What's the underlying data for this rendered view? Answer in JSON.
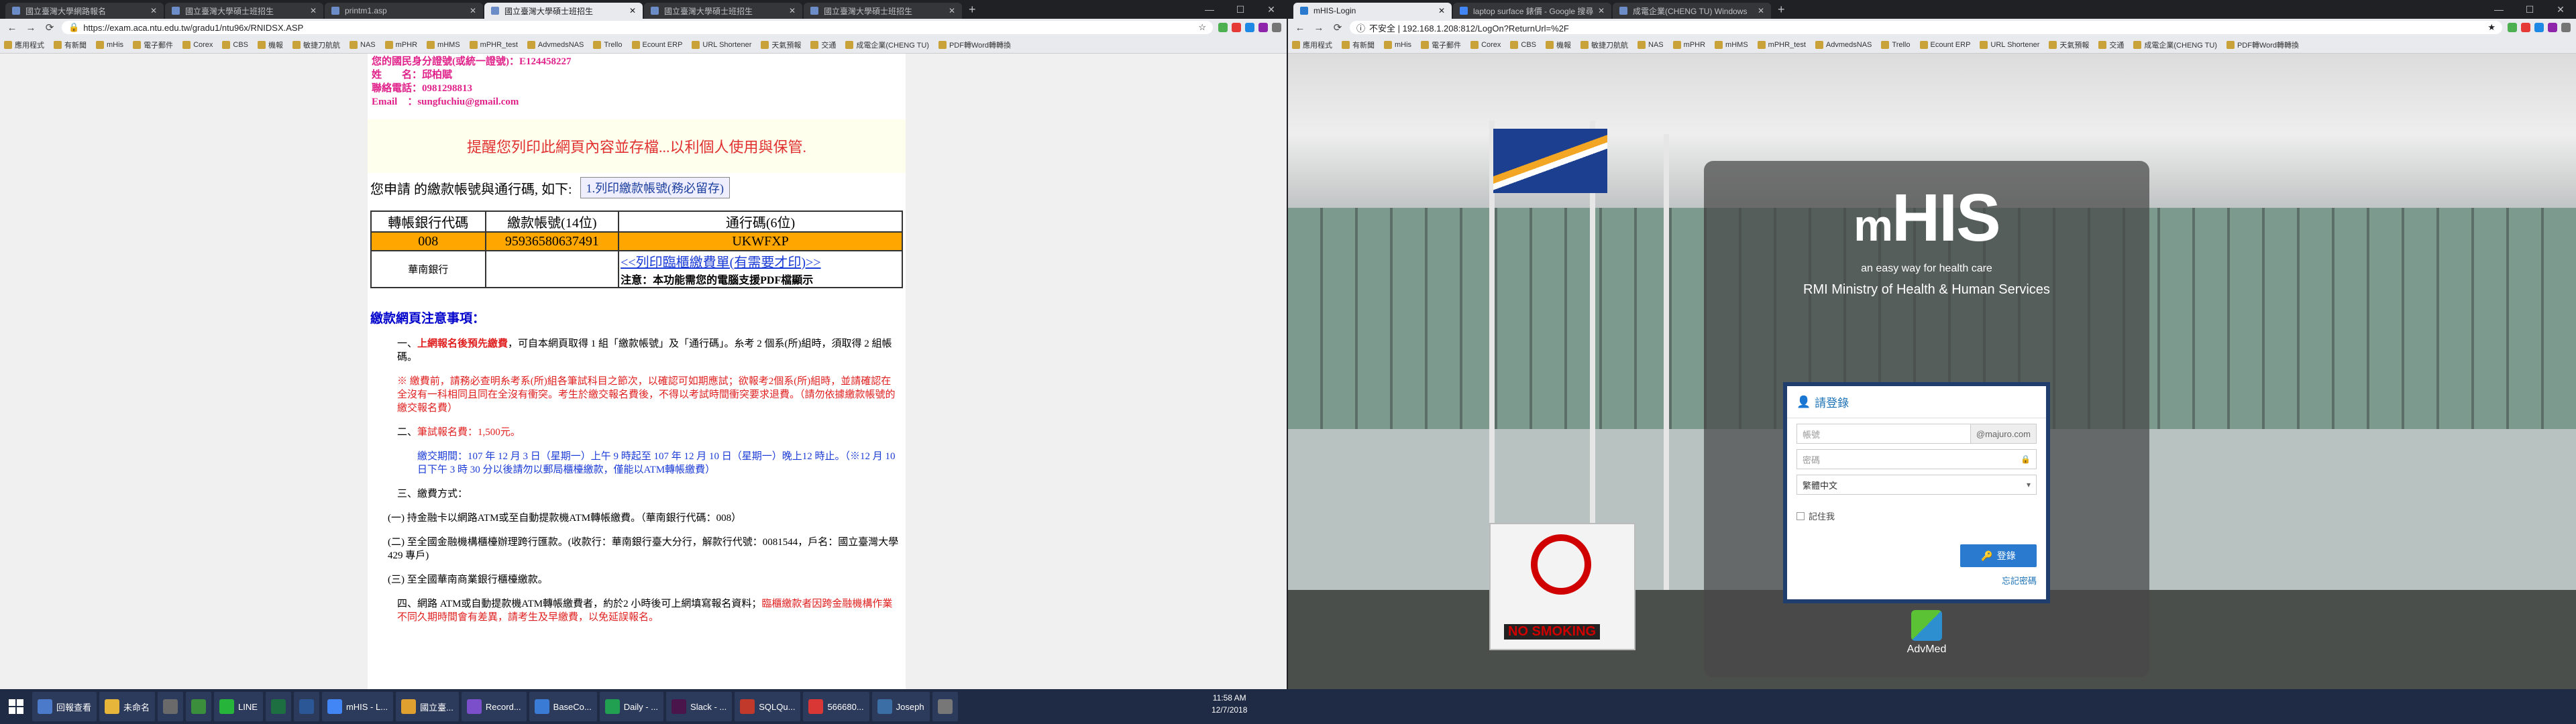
{
  "left": {
    "tabs": [
      "國立臺灣大學網路報名",
      "國立臺灣大學碩士班招生",
      "printm1.asp",
      "國立臺灣大學碩士班招生",
      "國立臺灣大學碩士班招生",
      "國立臺灣大學碩士班招生"
    ],
    "url": "https://exam.aca.ntu.edu.tw/gradu1/ntu96x/RNIDSX.ASP",
    "bookmarks": [
      "應用程式",
      "有新聞",
      "mHis",
      "電子郵件",
      "Corex",
      "CBS",
      "機報",
      "敏捷刀航航",
      "NAS",
      "mPHR",
      "mHMS",
      "mPHR_test",
      "AdvmedsNAS",
      "Trello",
      "Ecount ERP",
      "URL Shortener",
      "天氣預報",
      "交通",
      "成電企業(CHENG TU)",
      "PDF轉Word轉轉換"
    ],
    "applicant": {
      "id_line": "您的國民身分證號(或統一證號)：E124458227",
      "name_line": "姓　　名：邱柏賦",
      "phone_line": "聯絡電話：0981298813",
      "email_line": "Email　：sungfuchiu@gmail.com"
    },
    "notice": "提醒您列印此網頁內容並存檔...以利個人使用與保管.",
    "apply_label": "您申請 的繳款帳號與通行碼, 如下:",
    "print_button": "1.列印繳款帳號(務必留存)",
    "table": {
      "headers": [
        "轉帳銀行代碼",
        "繳款帳號(14位)",
        "通行碼(6位)"
      ],
      "row": [
        "008",
        "95936580637491",
        "UKWFXP"
      ],
      "bank_name": "華南銀行",
      "print_link": "<<列印臨櫃繳費單(有需要才印)>>",
      "pdf_note": "注意：本功能需您的電腦支援PDF檔顯示"
    },
    "notes_title": "繳款網頁注意事項：",
    "notes": [
      {
        "prefix": "一、",
        "red": "上網報名後預先繳費",
        "text": "，可自本網頁取得 1 組「繳款帳號」及「通行碼」。糸考 2 個系(所)組時，須取得 2 組帳碼。"
      },
      {
        "prefix": "※ ",
        "red": "繳費前，請務必查明糸考系(所)組各筆試科目之節次，以確認可如期應試；欲報考2個系(所)組時，並請確認在全沒有一科相同且同在全沒有衝突。考生於繳交報名費後，不得以考試時間衝突要求退費。（請勿依據繳款帳號的繳交報名費）",
        "text": ""
      },
      {
        "prefix": "二、",
        "red": "筆試報名費：1,500元。",
        "text": ""
      },
      {
        "prefix": "",
        "red": "",
        "text": "繳交期間：107 年 12 月 3 日（星期一）上午 9 時起至 107 年 12 月 10 日（星期一）晚上12 時止。（※12 月 10 日下午 3 時 30 分以後請勿以郵局櫃檯繳款，僅能以ATM轉帳繳費）"
      },
      {
        "prefix": "三、",
        "red": "",
        "text": "繳費方式："
      },
      {
        "prefix": "",
        "red": "",
        "text": "(一) 持金融卡以網路ATM或至自動提款機ATM轉帳繳費。（華南銀行代碼：008）"
      },
      {
        "prefix": "",
        "red": "",
        "text": "(二) 至全國金融機構櫃檯辦理跨行匯款。(收款行：華南銀行臺大分行，解款行代號：0081544，戶名：國立臺灣大學 429 專戶)"
      },
      {
        "prefix": "",
        "red": "",
        "text": "(三) 至全國華南商業銀行櫃檯繳款。"
      },
      {
        "prefix": "四、",
        "red": "",
        "text": "網路 ATM或自動提款機ATM轉帳繳費者，約於2 小時後可上網填寫報名資料；",
        "red2": "臨櫃繳款者因跨金融機構作業不同久期時間會有差異，請考生及早繳費，以免延誤報名。"
      }
    ]
  },
  "right": {
    "tabs": [
      "mHIS-Login",
      "laptop surface 錶價 - Google 搜尋",
      "成電企業(CHENG TU) Windows"
    ],
    "url": "不安全 | 192.168.1.208:812/LogOn?ReturnUrl=%2F",
    "bookmarks": [
      "應用程式",
      "有新聞",
      "mHis",
      "電子郵件",
      "Corex",
      "CBS",
      "機報",
      "敏捷刀航航",
      "NAS",
      "mPHR",
      "mHMS",
      "mPHR_test",
      "AdvmedsNAS",
      "Trello",
      "Ecount ERP",
      "URL Shortener",
      "天氣預報",
      "交通",
      "成電企業(CHENG TU)",
      "PDF轉Word轉轉換"
    ],
    "logo_m": "m",
    "logo_his": "HIS",
    "tagline": "an easy way for health care",
    "ministry": "RMI Ministry of Health & Human Services",
    "login_title": "請登錄",
    "account_placeholder": "帳號",
    "domain_suffix": "@majuro.com",
    "password_placeholder": "密碼",
    "language_value": "繁體中文",
    "remember_label": "記住我",
    "login_button": "登錄",
    "forgot_link": "忘記密碼",
    "adv_logo": "AdvMed",
    "sign_text": "NO SMOKING"
  },
  "taskbar": {
    "items": [
      "回報查看",
      "未命名",
      "",
      "",
      "LINE",
      "",
      "",
      "mHIS - L...",
      "國立臺...",
      "Record...",
      "BaseCo...",
      "Daily - ...",
      "Slack - ...",
      "SQLQu...",
      "566680...",
      "Joseph",
      ""
    ],
    "time": "11:58 AM",
    "date": "12/7/2018"
  },
  "colors": {
    "accent": "#1f3d6d",
    "login_btn": "#2a7bd0",
    "highlight_row": "#ffa700",
    "applicant": "#e0218a"
  }
}
